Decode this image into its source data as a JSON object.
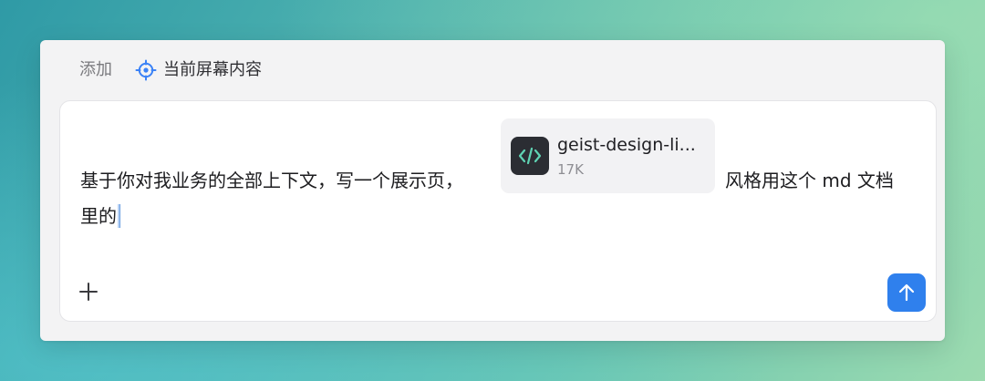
{
  "toolbar": {
    "add_label": "添加",
    "context_chip_label": "当前屏幕内容",
    "context_chip_icon": "crosshair-target-icon"
  },
  "composer": {
    "text_before_attachment": "基于你对我业务的全部上下文，写一个展示页，",
    "text_after_attachment": "风格用这个 md 文档",
    "text_line2": "里的",
    "attachment": {
      "name": "geist-design-li...",
      "size": "17K",
      "icon": "code-file-icon"
    },
    "add_icon": "plus-icon",
    "send_icon": "arrow-up-icon"
  },
  "colors": {
    "accent": "#2f80ed",
    "context_icon": "#3b82f6",
    "file_icon_bg": "#2b2d33",
    "file_icon_fg": "#5fd3b3"
  }
}
